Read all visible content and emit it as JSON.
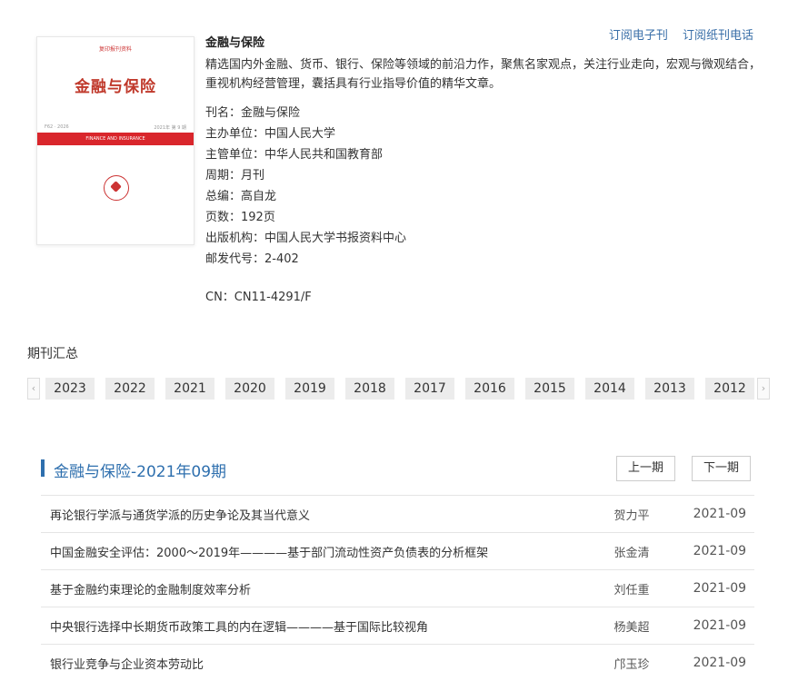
{
  "cover": {
    "top_text": "复印报刊资料",
    "title": "金融与保险",
    "small_left": "F62 · 2026",
    "small_right": "2021年 第 9 期",
    "band_text": "FINANCE AND INSURANCE"
  },
  "journal": {
    "title": "金融与保险",
    "description": "精选国内外金融、货币、银行、保险等领域的前沿力作，聚焦名家观点，关注行业走向，宏观与微观结合，重视机构经营管理，囊括具有行业指导价值的精华文章。",
    "info": [
      "刊名：金融与保险",
      "主办单位：中国人民大学",
      "主管单位：中华人民共和国教育部",
      "周期：月刊",
      "总编：高自龙",
      "页数：192页",
      "出版机构：中国人民大学书报资料中心",
      "邮发代号：2-402"
    ],
    "cn": "CN：CN11-4291/F"
  },
  "links": {
    "electronic": "订阅电子刊",
    "paper": "订阅纸刊电话"
  },
  "years_section": {
    "label": "期刊汇总",
    "years": [
      "2023",
      "2022",
      "2021",
      "2020",
      "2019",
      "2018",
      "2017",
      "2016",
      "2015",
      "2014",
      "2013",
      "2012"
    ]
  },
  "issue": {
    "title": "金融与保险-2021年09期",
    "prev": "上一期",
    "next": "下一期",
    "articles": [
      {
        "title": "再论银行学派与通货学派的历史争论及其当代意义",
        "author": "贺力平",
        "date": "2021-09"
      },
      {
        "title": "中国金融安全评估：2000～2019年————基于部门流动性资产负债表的分析框架",
        "author": "张金清",
        "date": "2021-09"
      },
      {
        "title": "基于金融约束理论的金融制度效率分析",
        "author": "刘任重",
        "date": "2021-09"
      },
      {
        "title": "中央银行选择中长期货币政策工具的内在逻辑————基于国际比较视角",
        "author": "杨美超",
        "date": "2021-09"
      },
      {
        "title": "银行业竞争与企业资本劳动比",
        "author": "邝玉珍",
        "date": "2021-09"
      }
    ]
  }
}
